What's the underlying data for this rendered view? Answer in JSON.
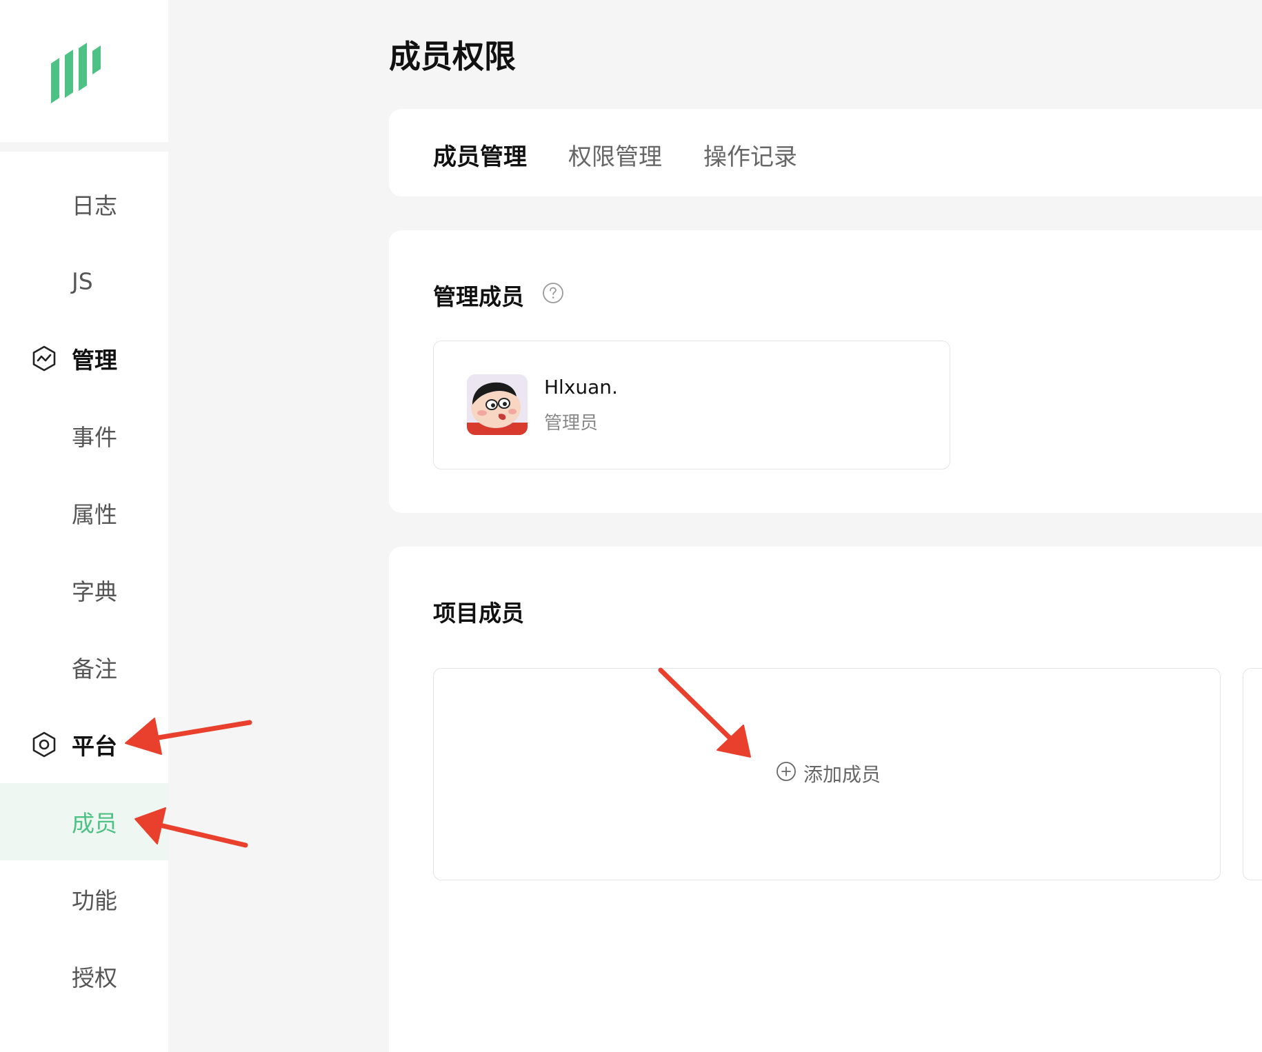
{
  "page": {
    "title": "成员权限"
  },
  "colors": {
    "accent": "#4ec184",
    "annotation": "#e8402d"
  },
  "sidebar": {
    "logo": "app-logo",
    "items": [
      {
        "label": "日志",
        "type": "item"
      },
      {
        "label": "JS",
        "type": "item"
      },
      {
        "label": "管理",
        "type": "group",
        "icon": "chart-hexagon-icon"
      },
      {
        "label": "事件",
        "type": "item"
      },
      {
        "label": "属性",
        "type": "item"
      },
      {
        "label": "字典",
        "type": "item"
      },
      {
        "label": "备注",
        "type": "item"
      },
      {
        "label": "平台",
        "type": "group",
        "icon": "settings-hexagon-icon"
      },
      {
        "label": "成员",
        "type": "item",
        "active": true
      },
      {
        "label": "功能",
        "type": "item"
      },
      {
        "label": "授权",
        "type": "item"
      }
    ]
  },
  "tabs": [
    {
      "label": "成员管理",
      "active": true
    },
    {
      "label": "权限管理",
      "active": false
    },
    {
      "label": "操作记录",
      "active": false
    }
  ],
  "admin_section": {
    "title": "管理成员",
    "help_icon": "question-circle-icon",
    "member": {
      "name": "Hlxuan.",
      "role": "管理员"
    }
  },
  "project_section": {
    "title": "项目成员",
    "add_label": "添加成员",
    "add_icon": "plus-circle-icon"
  }
}
